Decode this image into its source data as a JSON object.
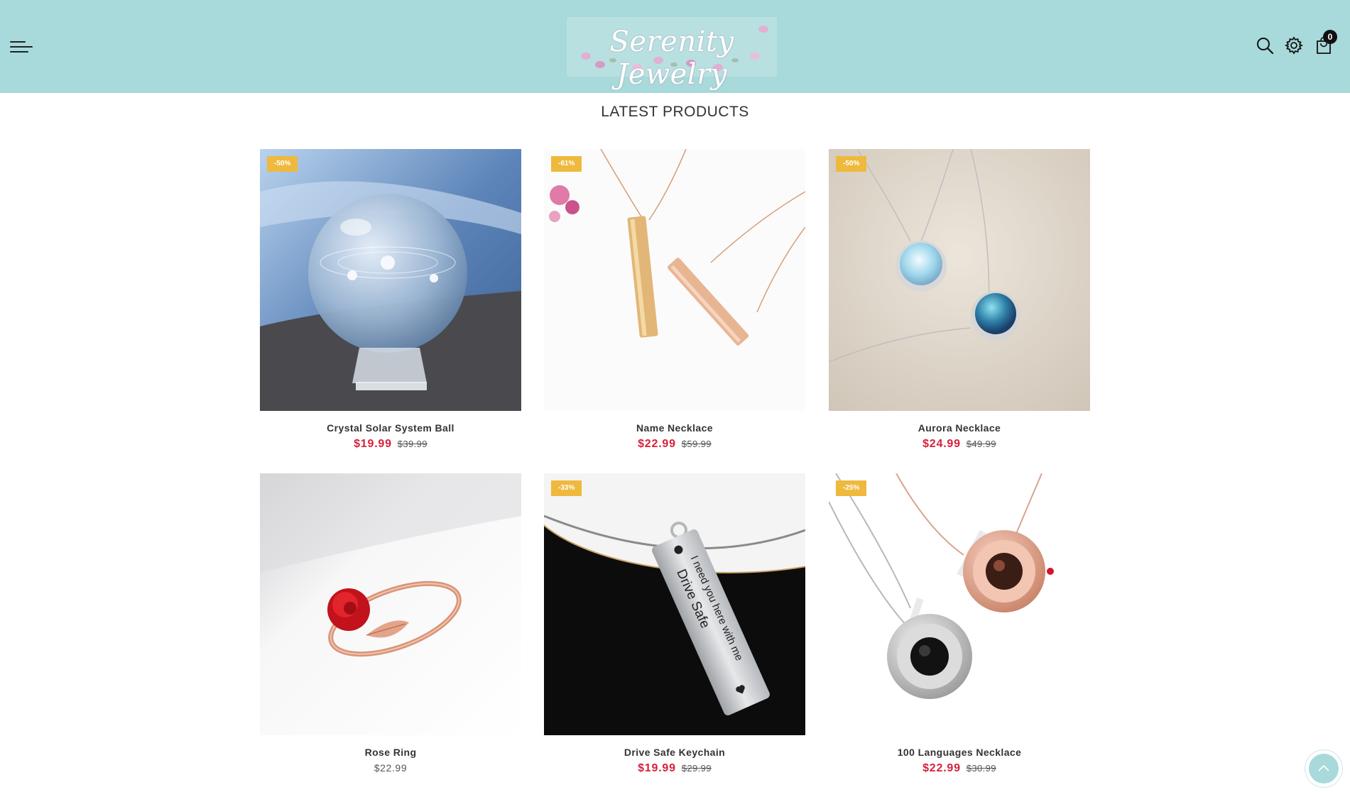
{
  "header": {
    "logo_text": "Serenity Jewelry",
    "cart_count": "0",
    "icons": [
      "menu-icon",
      "search-icon",
      "gear-icon",
      "shopping-bag-icon"
    ],
    "background_color": "#a8d9db"
  },
  "section": {
    "title": "LATEST PRODUCTS"
  },
  "products": [
    {
      "name": "Crystal Solar System Ball",
      "badge": "-50%",
      "price": "$19.99",
      "old_price": "$39.99"
    },
    {
      "name": "Name Necklace",
      "badge": "-61%",
      "price": "$22.99",
      "old_price": "$59.99"
    },
    {
      "name": "Aurora Necklace",
      "badge": "-50%",
      "price": "$24.99",
      "old_price": "$49.99"
    },
    {
      "name": "Rose Ring",
      "badge": "",
      "price": "$22.99",
      "old_price": ""
    },
    {
      "name": "Drive Safe Keychain",
      "badge": "-33%",
      "price": "$19.99",
      "old_price": "$29.99",
      "engraving_line1": "Drive Safe",
      "engraving_line2": "I need you here with me"
    },
    {
      "name": "100 Languages Necklace",
      "badge": "-25%",
      "price": "$22.99",
      "old_price": "$30.99"
    }
  ],
  "colors": {
    "sale_price": "#d71f3a",
    "badge": "#eeb93d",
    "accent": "#a8d9db"
  }
}
